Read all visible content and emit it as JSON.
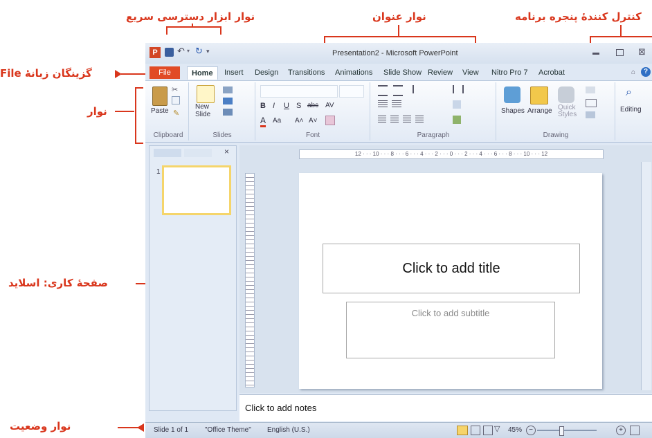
{
  "annotations": {
    "quick_access": "نوار ابزار دسترسی سریع",
    "title_bar": "نوار عنوان",
    "window_control": "کنترل کنندهٔ پنجره برنامه",
    "file_tab": "گزینگان زبانهٔ File",
    "ribbon": "نوار",
    "workspace": "صفحهٔ کاری: اسلاید",
    "status_bar": "نوار وضعیت"
  },
  "window": {
    "title": "Presentation2 - Microsoft PowerPoint",
    "app_icon": "P"
  },
  "tabs": [
    "File",
    "Home",
    "Insert",
    "Design",
    "Transitions",
    "Animations",
    "Slide Show",
    "Review",
    "View",
    "Nitro Pro 7",
    "Acrobat"
  ],
  "ribbon": {
    "clipboard": {
      "label": "Clipboard",
      "paste": "Paste"
    },
    "slides": {
      "label": "Slides",
      "new_slide": "New Slide"
    },
    "font": {
      "label": "Font"
    },
    "paragraph": {
      "label": "Paragraph"
    },
    "drawing": {
      "label": "Drawing",
      "shapes": "Shapes",
      "arrange": "Arrange",
      "quick_styles": "Quick Styles"
    },
    "editing": {
      "label": "Editing"
    }
  },
  "slide_panel": {
    "thumb_number": "1"
  },
  "ruler": {
    "text": "12 · · · 10 · · · 8 · · · 6 · · · 4 · · · 2 · · · 0 · · · 2 · · · 4 · · · 6 · · · 8 · · · 10 · · · 12"
  },
  "slide": {
    "title_placeholder": "Click to add title",
    "subtitle_placeholder": "Click to add subtitle"
  },
  "notes": {
    "placeholder": "Click to add notes"
  },
  "status": {
    "slide_info": "Slide 1 of 1",
    "theme": "\"Office Theme\"",
    "language": "English (U.S.)",
    "zoom": "45%"
  },
  "colors": {
    "accent": "#d9361c",
    "file_tab": "#e14b26"
  }
}
